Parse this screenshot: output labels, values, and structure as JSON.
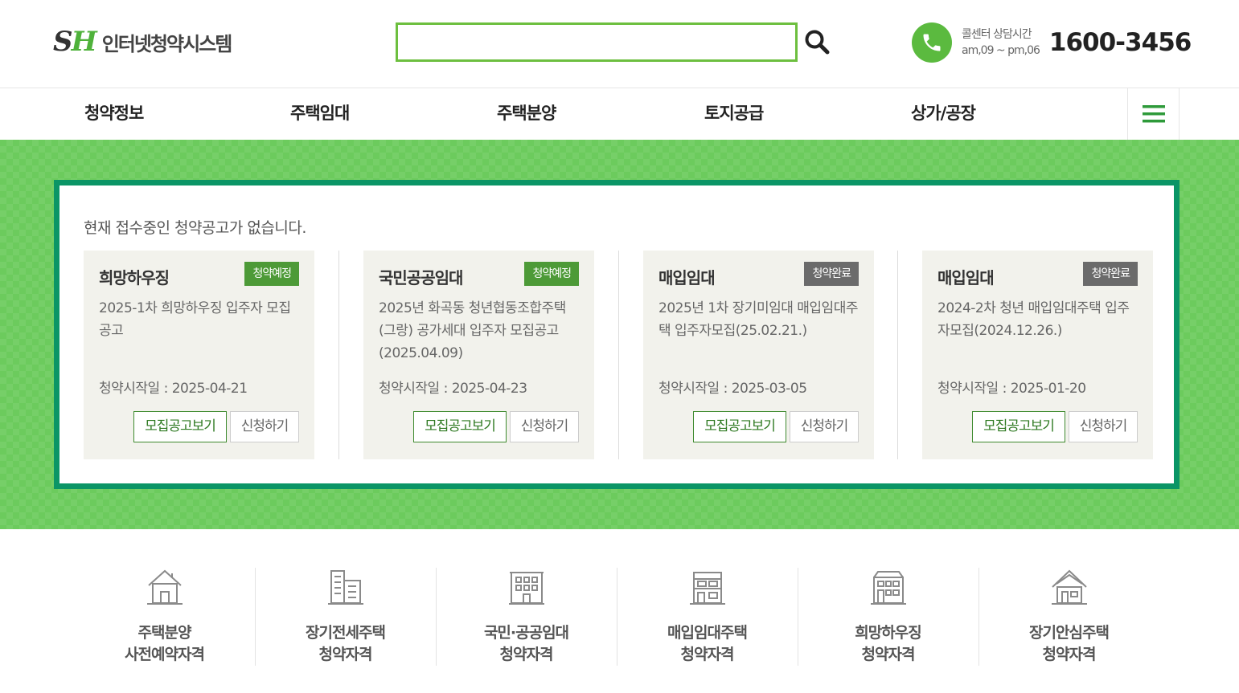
{
  "header": {
    "logo_mark_s": "S",
    "logo_mark_h": "H",
    "logo_text": "인터넷청약시스템",
    "search_value": "",
    "search_placeholder": "",
    "call_label_1": "콜센터 상담시간",
    "call_label_2": "am,09 ~ pm,06",
    "call_number": "1600-3456"
  },
  "nav": {
    "items": [
      "청약정보",
      "주택임대",
      "주택분양",
      "토지공급",
      "상가/공장"
    ],
    "menu_icon": "hamburger-icon"
  },
  "main": {
    "notice": "현재 접수중인 청약공고가 없습니다.",
    "cards": [
      {
        "title": "희망하우징",
        "badge": "청약예정",
        "badge_color": "#4d9a37",
        "desc": "2025-1차 희망하우징 입주자 모집공고",
        "date": "청약시작일 : 2025-04-21",
        "btn_notice": "모집공고보기",
        "btn_apply": "신청하기"
      },
      {
        "title": "국민공공임대",
        "badge": "청약예정",
        "badge_color": "#4d9a37",
        "desc": "2025년 화곡동 청년협동조합주택(그랑) 공가세대 입주자 모집공고(2025.04.09)",
        "date": "청약시작일 : 2025-04-23",
        "btn_notice": "모집공고보기",
        "btn_apply": "신청하기"
      },
      {
        "title": "매입임대",
        "badge": "청약완료",
        "badge_color": "#6b6b6b",
        "desc": "2025년 1차 장기미임대 매입임대주택 입주자모집(25.02.21.)",
        "date": "청약시작일 : 2025-03-05",
        "btn_notice": "모집공고보기",
        "btn_apply": "신청하기"
      },
      {
        "title": "매입임대",
        "badge": "청약완료",
        "badge_color": "#6b6b6b",
        "desc": "2024-2차 청년 매입임대주택 입주자모집(2024.12.26.)",
        "date": "청약시작일 : 2025-01-20",
        "btn_notice": "모집공고보기",
        "btn_apply": "신청하기"
      }
    ]
  },
  "quick_links": [
    {
      "line1": "주택분양",
      "line2": "사전예약자격",
      "icon": "house-icon"
    },
    {
      "line1": "장기전세주택",
      "line2": "청약자격",
      "icon": "apartment-icon"
    },
    {
      "line1": "국민·공공임대",
      "line2": "청약자격",
      "icon": "building-icon"
    },
    {
      "line1": "매입임대주택",
      "line2": "청약자격",
      "icon": "multiplex-icon"
    },
    {
      "line1": "희망하우징",
      "line2": "청약자격",
      "icon": "dormitory-icon"
    },
    {
      "line1": "장기안심주택",
      "line2": "청약자격",
      "icon": "home-safe-icon"
    }
  ],
  "colors": {
    "brand_green": "#4fb23b",
    "band_green": "#6ccb5d",
    "panel_border": "#0b9566"
  }
}
